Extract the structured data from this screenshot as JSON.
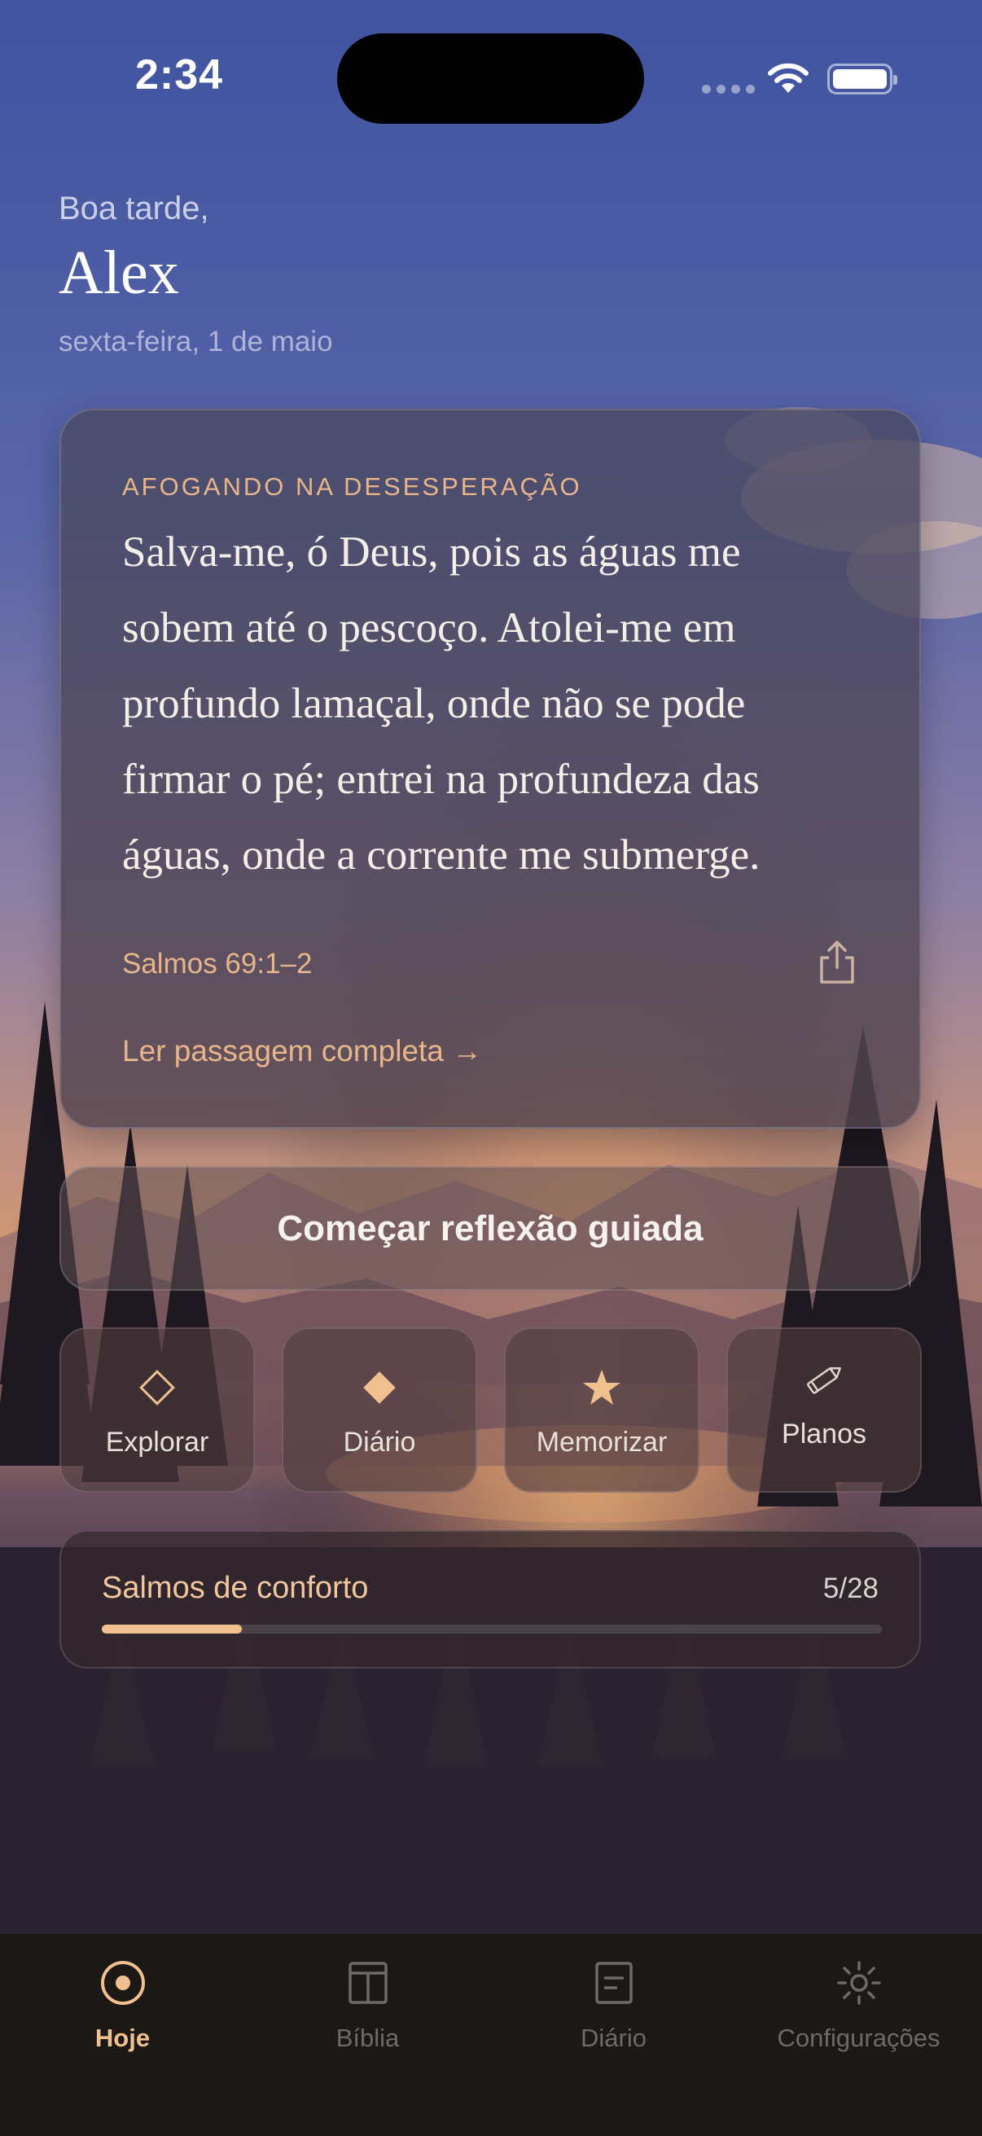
{
  "status_bar": {
    "time": "2:34"
  },
  "header": {
    "greeting": "Boa tarde,",
    "name": "Alex",
    "date": "sexta-feira, 1 de maio"
  },
  "verse_card": {
    "tag": "AFOGANDO NA DESESPERAÇÃO",
    "lines": [
      "Salva-me, ó Deus, pois as águas me",
      "sobem até o pescoço. Atolei-me em",
      "profundo lamaçal, onde não se pode",
      "firmar o pé; entrei na profundeza das",
      "águas, onde a corrente me submerge."
    ],
    "reference": "Salmos 69:1–2",
    "share_icon": "share-icon",
    "read_link": "Ler passagem completa →"
  },
  "reflection_button": {
    "label": "Começar reflexão guiada"
  },
  "quick_actions": [
    {
      "label": "Explorar",
      "icon": "diamond-outline-icon"
    },
    {
      "label": "Diário",
      "icon": "diamond-filled-icon"
    },
    {
      "label": "Memorizar",
      "icon": "star-icon"
    },
    {
      "label": "Planos",
      "icon": "pencil-icon"
    }
  ],
  "plan": {
    "title": "Salmos de conforto",
    "progress_text": "5/28",
    "progress": 0.18
  },
  "tab_bar": {
    "tabs": [
      {
        "label": "Hoje",
        "icon": "target-icon",
        "active": true
      },
      {
        "label": "Bíblia",
        "icon": "book-layout-icon",
        "active": false
      },
      {
        "label": "Diário",
        "icon": "journal-icon",
        "active": false
      },
      {
        "label": "Configurações",
        "icon": "sun-gear-icon",
        "active": false
      }
    ]
  },
  "colors": {
    "accent": "#E8B58A",
    "tab_active": "#F0C08F",
    "tab_inactive": "#6E6A68",
    "sky_top": "#3E529E",
    "sunset": "#D9945C"
  }
}
